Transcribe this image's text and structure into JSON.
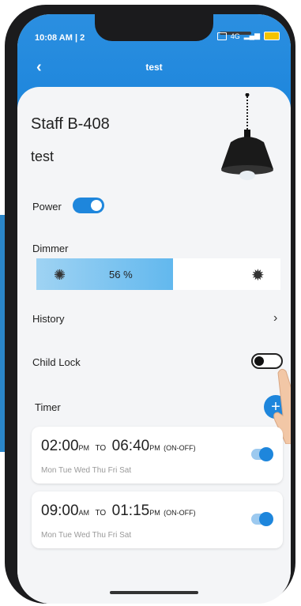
{
  "status_bar": {
    "time": "10:08 AM | 2",
    "network_label": "4G"
  },
  "header": {
    "back_glyph": "‹",
    "title": "test"
  },
  "device": {
    "name": "Staff  B-408",
    "room": "test"
  },
  "power": {
    "label": "Power",
    "on": true
  },
  "dimmer": {
    "label": "Dimmer",
    "value_text": "56  %",
    "level_percent": 56
  },
  "history": {
    "label": "History",
    "chevron": "›"
  },
  "child_lock": {
    "label": "Child  Lock",
    "on": false
  },
  "timer": {
    "label": "Timer",
    "add_glyph": "+"
  },
  "timers": [
    {
      "start": "02:00",
      "start_ampm": "PM",
      "to": "TO",
      "end": "06:40",
      "end_ampm": "PM",
      "mode": "(ON-OFF)",
      "days": "Mon Tue Wed Thu Fri Sat",
      "enabled": true
    },
    {
      "start": "09:00",
      "start_ampm": "AM",
      "to": "TO",
      "end": "01:15",
      "end_ampm": "PM",
      "mode": "(ON-OFF)",
      "days": "Mon Tue Wed Thu Fri Sat",
      "enabled": true
    }
  ],
  "colors": {
    "accent": "#1e86dc",
    "dimmer_fill": "#62b8ee"
  }
}
